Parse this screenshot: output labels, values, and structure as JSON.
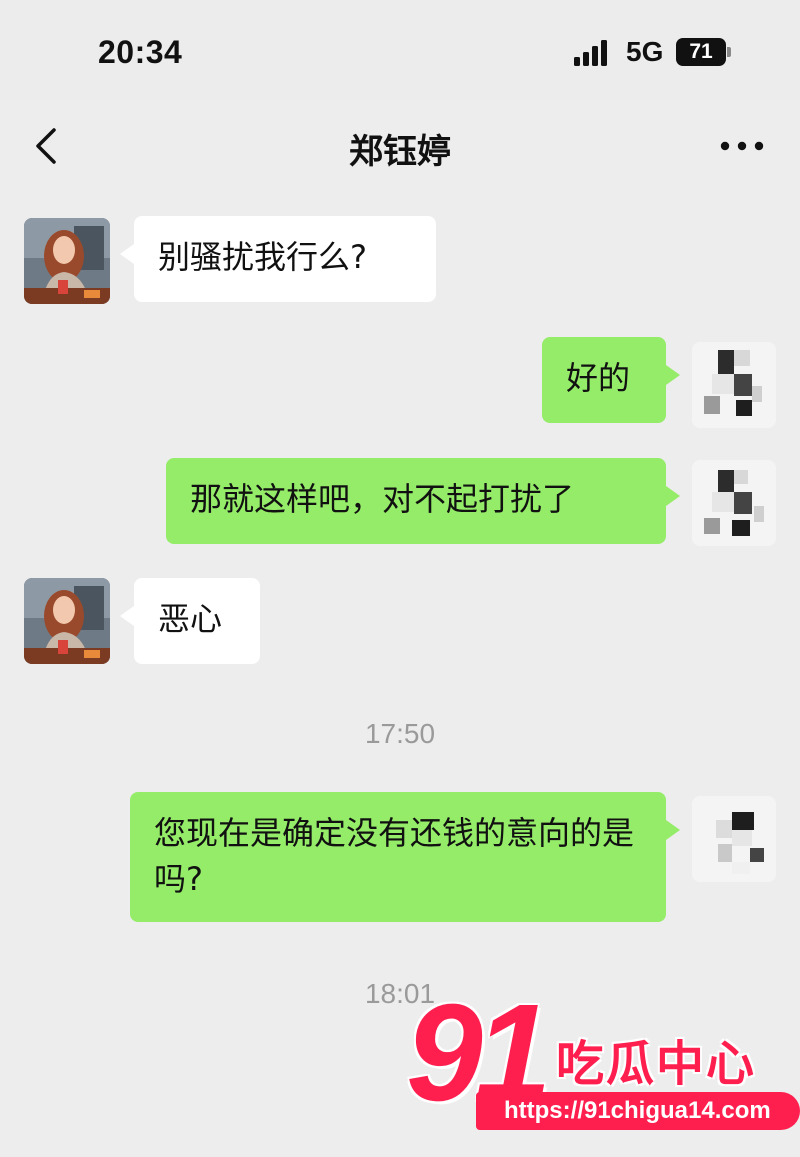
{
  "status_bar": {
    "time": "20:34",
    "network": "5G",
    "battery": "71"
  },
  "nav": {
    "back_icon": "chevron-left-icon",
    "title": "郑钰婷",
    "more_icon": "more-dots-icon"
  },
  "messages": [
    {
      "side": "left",
      "text": "别骚扰我行么?"
    },
    {
      "side": "right",
      "text": "好的"
    },
    {
      "side": "right",
      "text": "那就这样吧，对不起打扰了"
    },
    {
      "side": "left",
      "text": "恶心"
    },
    {
      "side": "time",
      "text": "17:50"
    },
    {
      "side": "right",
      "text": "您现在是确定没有还钱的意向的是吗?"
    },
    {
      "side": "time",
      "text": "18:01"
    }
  ],
  "watermark": {
    "number": "91",
    "brand": "吃瓜中心",
    "url": "https://91chigua14.com"
  },
  "colors": {
    "background": "#ededed",
    "left_bubble": "#ffffff",
    "right_bubble": "#95ec69",
    "watermark": "#ff1f4f"
  }
}
